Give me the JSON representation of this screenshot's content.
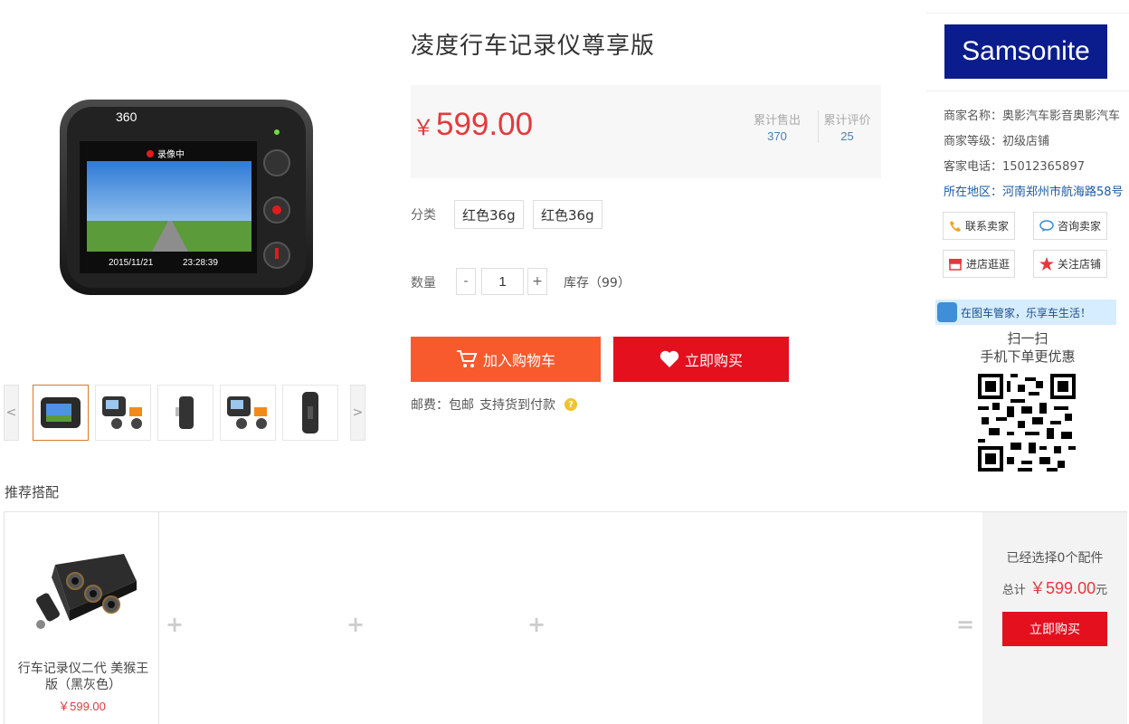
{
  "product": {
    "title": "凌度行车记录仪尊享版",
    "currency": "￥",
    "price": "599.00",
    "sold_label": "累计售出",
    "sold_count": "370",
    "review_label": "累计评价",
    "review_count": "25",
    "category_label": "分类",
    "options": [
      "红色36g",
      "红色36g"
    ],
    "quantity_label": "数量",
    "qty_minus": "-",
    "qty_plus": "+",
    "quantity": "1",
    "stock": "库存（99）",
    "add_cart_label": "加入购物车",
    "buy_now_label": "立即购买",
    "shipping": "邮费：包邮",
    "cod": "支持货到付款",
    "help_mark": "?"
  },
  "camera_screen": {
    "recording": "录像中",
    "date": "2015/11/21",
    "time": "23:28:39",
    "brand": "360"
  },
  "gallery": {
    "prev": "<",
    "next": ">"
  },
  "shop": {
    "logo_text": "Samsonite",
    "name": "商家名称：奥影汽车影音奥影汽车",
    "level": "商家等级：初级店铺",
    "phone": "客家电话：15012365897",
    "location": "所在地区：河南郑州市航海路58号",
    "contact_label": "联系卖家",
    "consult_label": "咨询卖家",
    "visit_label": "进店逛逛",
    "follow_label": "关注店铺",
    "banner_text": "在图车管家，乐享车生活！",
    "scan_line1": "扫一扫",
    "scan_line2": "手机下单更优惠"
  },
  "recommend": {
    "title": "推荐搭配",
    "item_name": "行车记录仪二代 美猴王版（黑灰色）",
    "item_price": "￥599.00",
    "plus": "+",
    "equals": "=",
    "selected_text": "已经选择0个配件",
    "total_label": "总计",
    "total_amount": "￥599.00",
    "total_unit": "元",
    "buy_label": "立即购买"
  },
  "colors": {
    "price_red": "#e4393c",
    "cart_orange": "#f85a2e",
    "buy_red": "#e4101e",
    "link_blue": "#1a5aa8",
    "samsonite_navy": "#0b1c8c"
  }
}
